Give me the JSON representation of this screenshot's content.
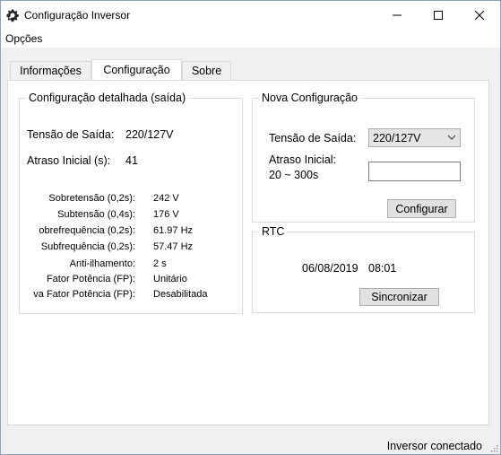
{
  "window": {
    "title": "Configuração Inversor"
  },
  "menu": {
    "options_label": "Opções"
  },
  "tabs": [
    {
      "label": "Informações",
      "active": false
    },
    {
      "label": "Configuração",
      "active": true
    },
    {
      "label": "Sobre",
      "active": false
    }
  ],
  "detail": {
    "legend": "Configuração detalhada (saída)",
    "voltage_label": "Tensão de Saída:",
    "voltage_value": "220/127V",
    "delay_label": "Atraso Inicial (s):",
    "delay_value": "41",
    "rows": [
      {
        "label": "Sobretensão (0,2s):",
        "value": "242 V"
      },
      {
        "label": "Subtensão (0,4s):",
        "value": "176 V"
      },
      {
        "label": "obrefrequência (0,2s):",
        "value": "61.97 Hz"
      },
      {
        "label": "Subfrequência (0,2s):",
        "value": "57.47 Hz"
      },
      {
        "label": "Anti-ilhamento:",
        "value": "2 s"
      },
      {
        "label": "Fator Potência (FP):",
        "value": "Unitário"
      },
      {
        "label": "va Fator Potência (FP):",
        "value": "Desabilitada"
      }
    ]
  },
  "newconfig": {
    "legend": "Nova Configuração",
    "voltage_label": "Tensão de Saída:",
    "voltage_selected": "220/127V",
    "delay_label_line1": "Atraso Inicial:",
    "delay_label_line2": "20 ~ 300s",
    "delay_value": "",
    "configure_button": "Configurar"
  },
  "rtc": {
    "legend": "RTC",
    "date": "06/08/2019",
    "time": "08:01",
    "sync_button": "Sincronizar"
  },
  "status": {
    "text": "Inversor conectado"
  }
}
